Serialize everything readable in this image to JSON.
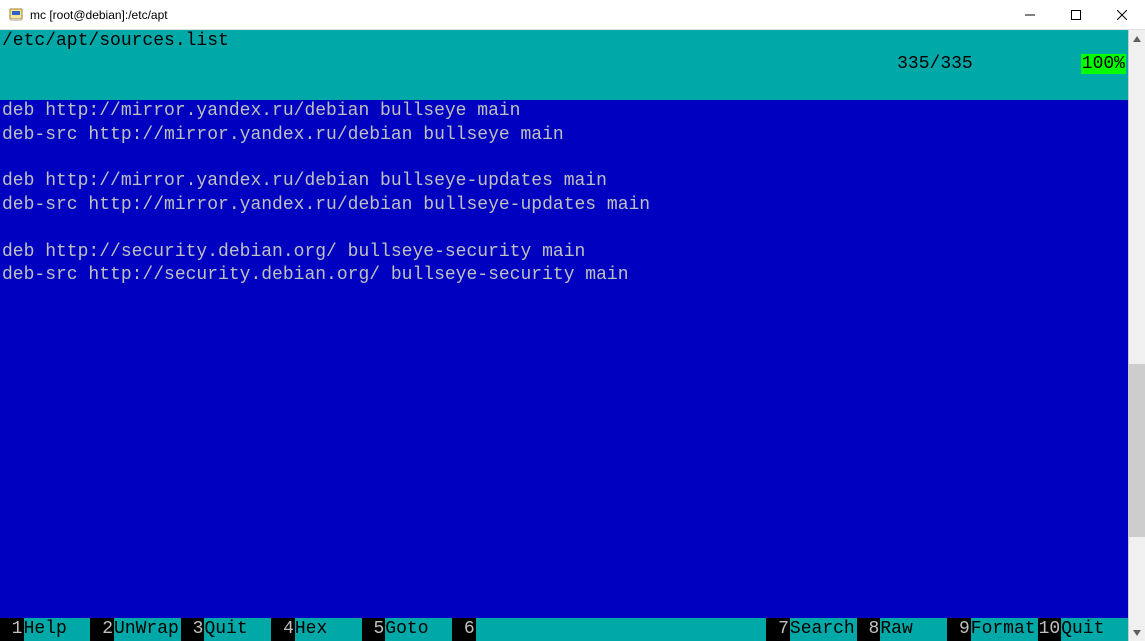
{
  "window": {
    "title": "mc [root@debian]:/etc/apt"
  },
  "status": {
    "path": "/etc/apt/sources.list",
    "position": "335/335",
    "percent": "100%"
  },
  "file": {
    "lines": [
      "deb http://mirror.yandex.ru/debian bullseye main",
      "deb-src http://mirror.yandex.ru/debian bullseye main",
      "",
      "deb http://mirror.yandex.ru/debian bullseye-updates main",
      "deb-src http://mirror.yandex.ru/debian bullseye-updates main",
      "",
      "deb http://security.debian.org/ bullseye-security main",
      "deb-src http://security.debian.org/ bullseye-security main"
    ]
  },
  "fkeys": [
    {
      "num": "1",
      "label": "Help"
    },
    {
      "num": "2",
      "label": "UnWrap"
    },
    {
      "num": "3",
      "label": "Quit"
    },
    {
      "num": "4",
      "label": "Hex"
    },
    {
      "num": "5",
      "label": "Goto"
    },
    {
      "num": "6",
      "label": ""
    },
    {
      "num": "7",
      "label": "Search"
    },
    {
      "num": "8",
      "label": "Raw"
    },
    {
      "num": "9",
      "label": "Format"
    },
    {
      "num": "10",
      "label": "Quit"
    }
  ]
}
